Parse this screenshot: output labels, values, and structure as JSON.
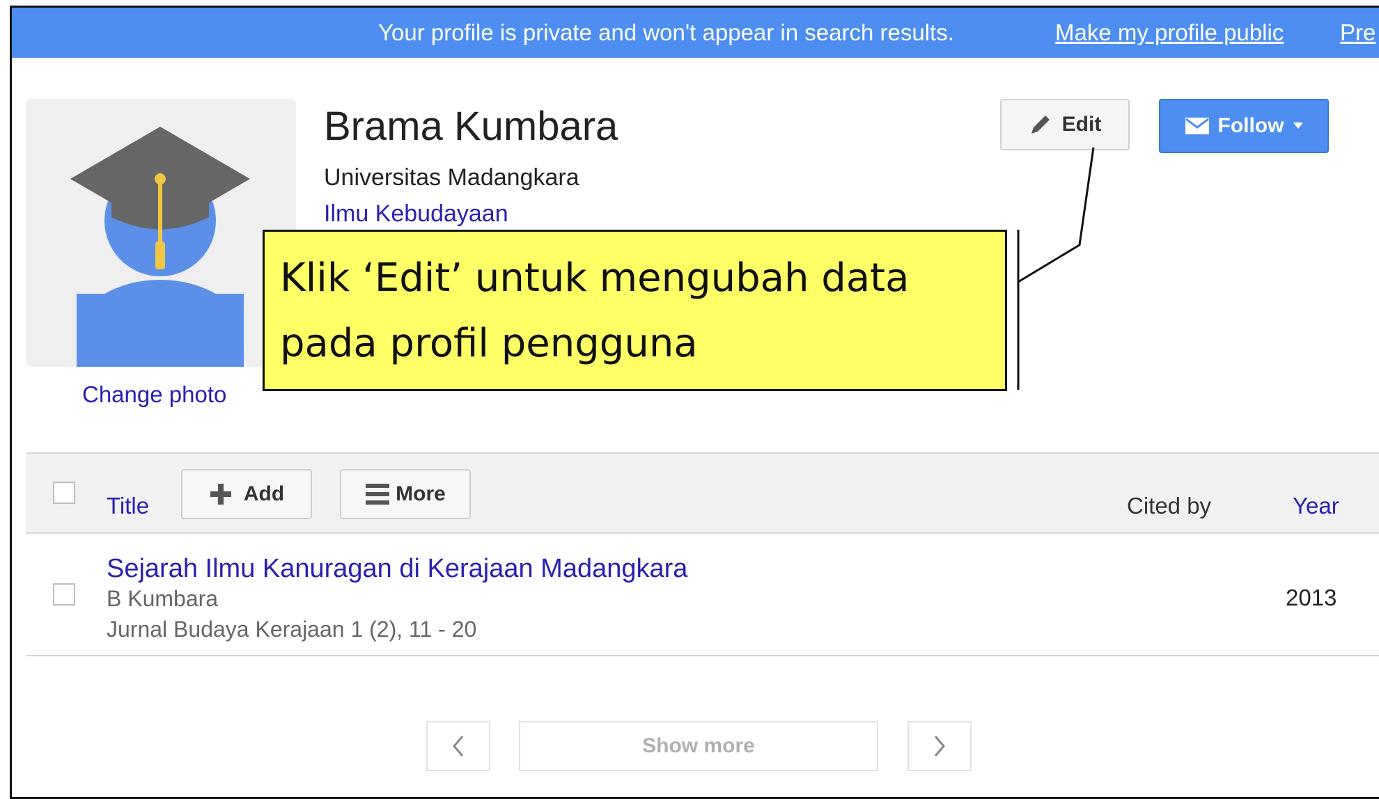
{
  "banner": {
    "message": "Your profile is private and won't appear in search results.",
    "make_public_link": "Make my profile public",
    "preview_link": "Pre"
  },
  "profile": {
    "name": "Brama Kumbara",
    "affiliation": "Universitas Madangkara",
    "field": "Ilmu Kebudayaan",
    "change_photo": "Change photo"
  },
  "actions": {
    "edit_label": "Edit",
    "follow_label": "Follow"
  },
  "callout": {
    "line1": "Klik ‘Edit’ untuk mengubah data",
    "line2": "pada profil pengguna"
  },
  "table": {
    "header": {
      "title": "Title",
      "add": "Add",
      "more": "More",
      "cited_by": "Cited by",
      "year": "Year"
    },
    "rows": [
      {
        "title": "Sejarah Ilmu Kanuragan di Kerajaan Madangkara",
        "authors": "B Kumbara",
        "journal": "Jurnal Budaya Kerajaan 1 (2), 11 - 20",
        "cited_by": "",
        "year": "2013"
      }
    ]
  },
  "pagination": {
    "show_more": "Show more"
  },
  "colors": {
    "banner": "#4d8ef0",
    "link": "#2a1fb3",
    "callout": "#ffff66",
    "follow_button": "#4d8ef0"
  }
}
